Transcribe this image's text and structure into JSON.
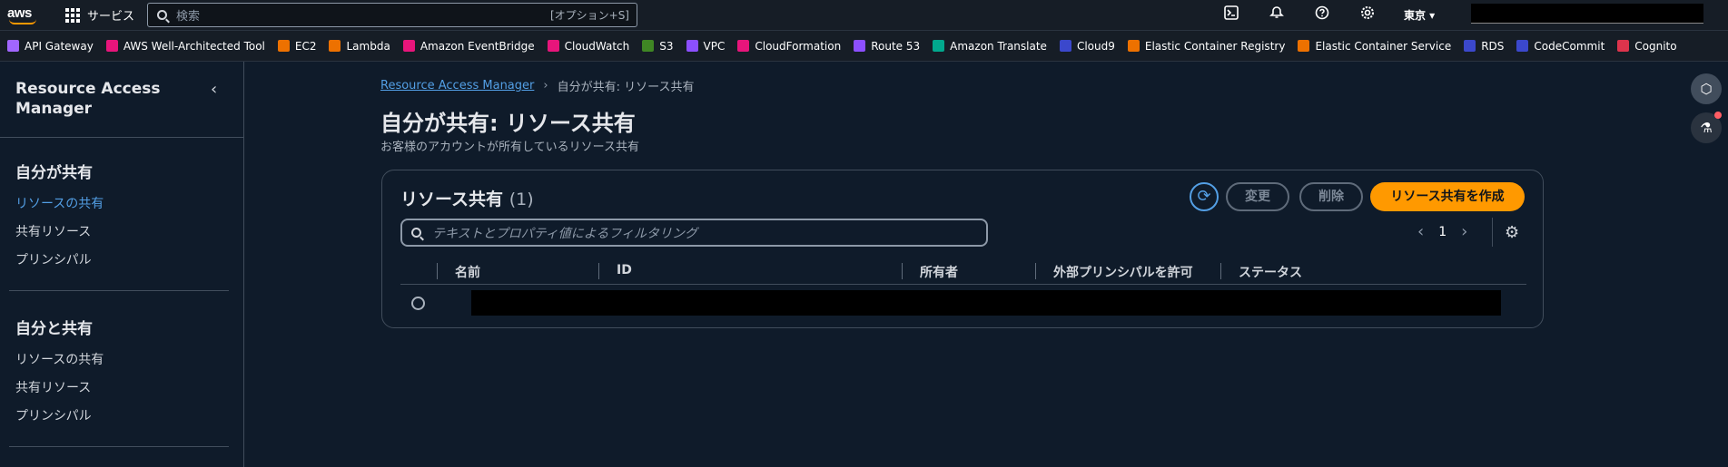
{
  "topnav": {
    "logo": "aws",
    "services_label": "サービス",
    "search_placeholder": "検索",
    "search_shortcut": "[オプション+S]",
    "region": "東京 ▾",
    "icons": [
      "cloudshell-icon",
      "bell-icon",
      "help-icon",
      "gear-icon"
    ]
  },
  "favorites": [
    {
      "label": "API Gateway",
      "color": "#a166ff"
    },
    {
      "label": "AWS Well-Architected Tool",
      "color": "#e7157b"
    },
    {
      "label": "EC2",
      "color": "#ed7100"
    },
    {
      "label": "Lambda",
      "color": "#ed7100"
    },
    {
      "label": "Amazon EventBridge",
      "color": "#e7157b"
    },
    {
      "label": "CloudWatch",
      "color": "#e7157b"
    },
    {
      "label": "S3",
      "color": "#3f8624"
    },
    {
      "label": "VPC",
      "color": "#8c4fff"
    },
    {
      "label": "CloudFormation",
      "color": "#e7157b"
    },
    {
      "label": "Route 53",
      "color": "#8c4fff"
    },
    {
      "label": "Amazon Translate",
      "color": "#01a88d"
    },
    {
      "label": "Cloud9",
      "color": "#3b48cc"
    },
    {
      "label": "Elastic Container Registry",
      "color": "#ed7100"
    },
    {
      "label": "Elastic Container Service",
      "color": "#ed7100"
    },
    {
      "label": "RDS",
      "color": "#3b48cc"
    },
    {
      "label": "CodeCommit",
      "color": "#3b48cc"
    },
    {
      "label": "Cognito",
      "color": "#dd344c"
    }
  ],
  "sidebar": {
    "title": "Resource Access Manager",
    "section1": "自分が共有",
    "section1_items": [
      "リソースの共有",
      "共有リソース",
      "プリンシパル"
    ],
    "section2": "自分と共有",
    "section2_items": [
      "リソースの共有",
      "共有リソース",
      "プリンシパル"
    ]
  },
  "main": {
    "breadcrumb_root": "Resource Access Manager",
    "breadcrumb_current": "自分が共有: リソース共有",
    "title": "自分が共有: リソース共有",
    "subtitle": "お客様のアカウントが所有しているリソース共有",
    "panel_title": "リソース共有",
    "panel_count": "(1)",
    "btn_modify": "変更",
    "btn_delete": "削除",
    "btn_create": "リソース共有を作成",
    "filter_placeholder": "テキストとプロパティ値によるフィルタリング",
    "page_number": "1",
    "columns": [
      "名前",
      "ID",
      "所有者",
      "外部プリンシパルを許可",
      "ステータス"
    ]
  },
  "colors": {
    "accent": "#539fe5",
    "primary": "#ff9900"
  }
}
